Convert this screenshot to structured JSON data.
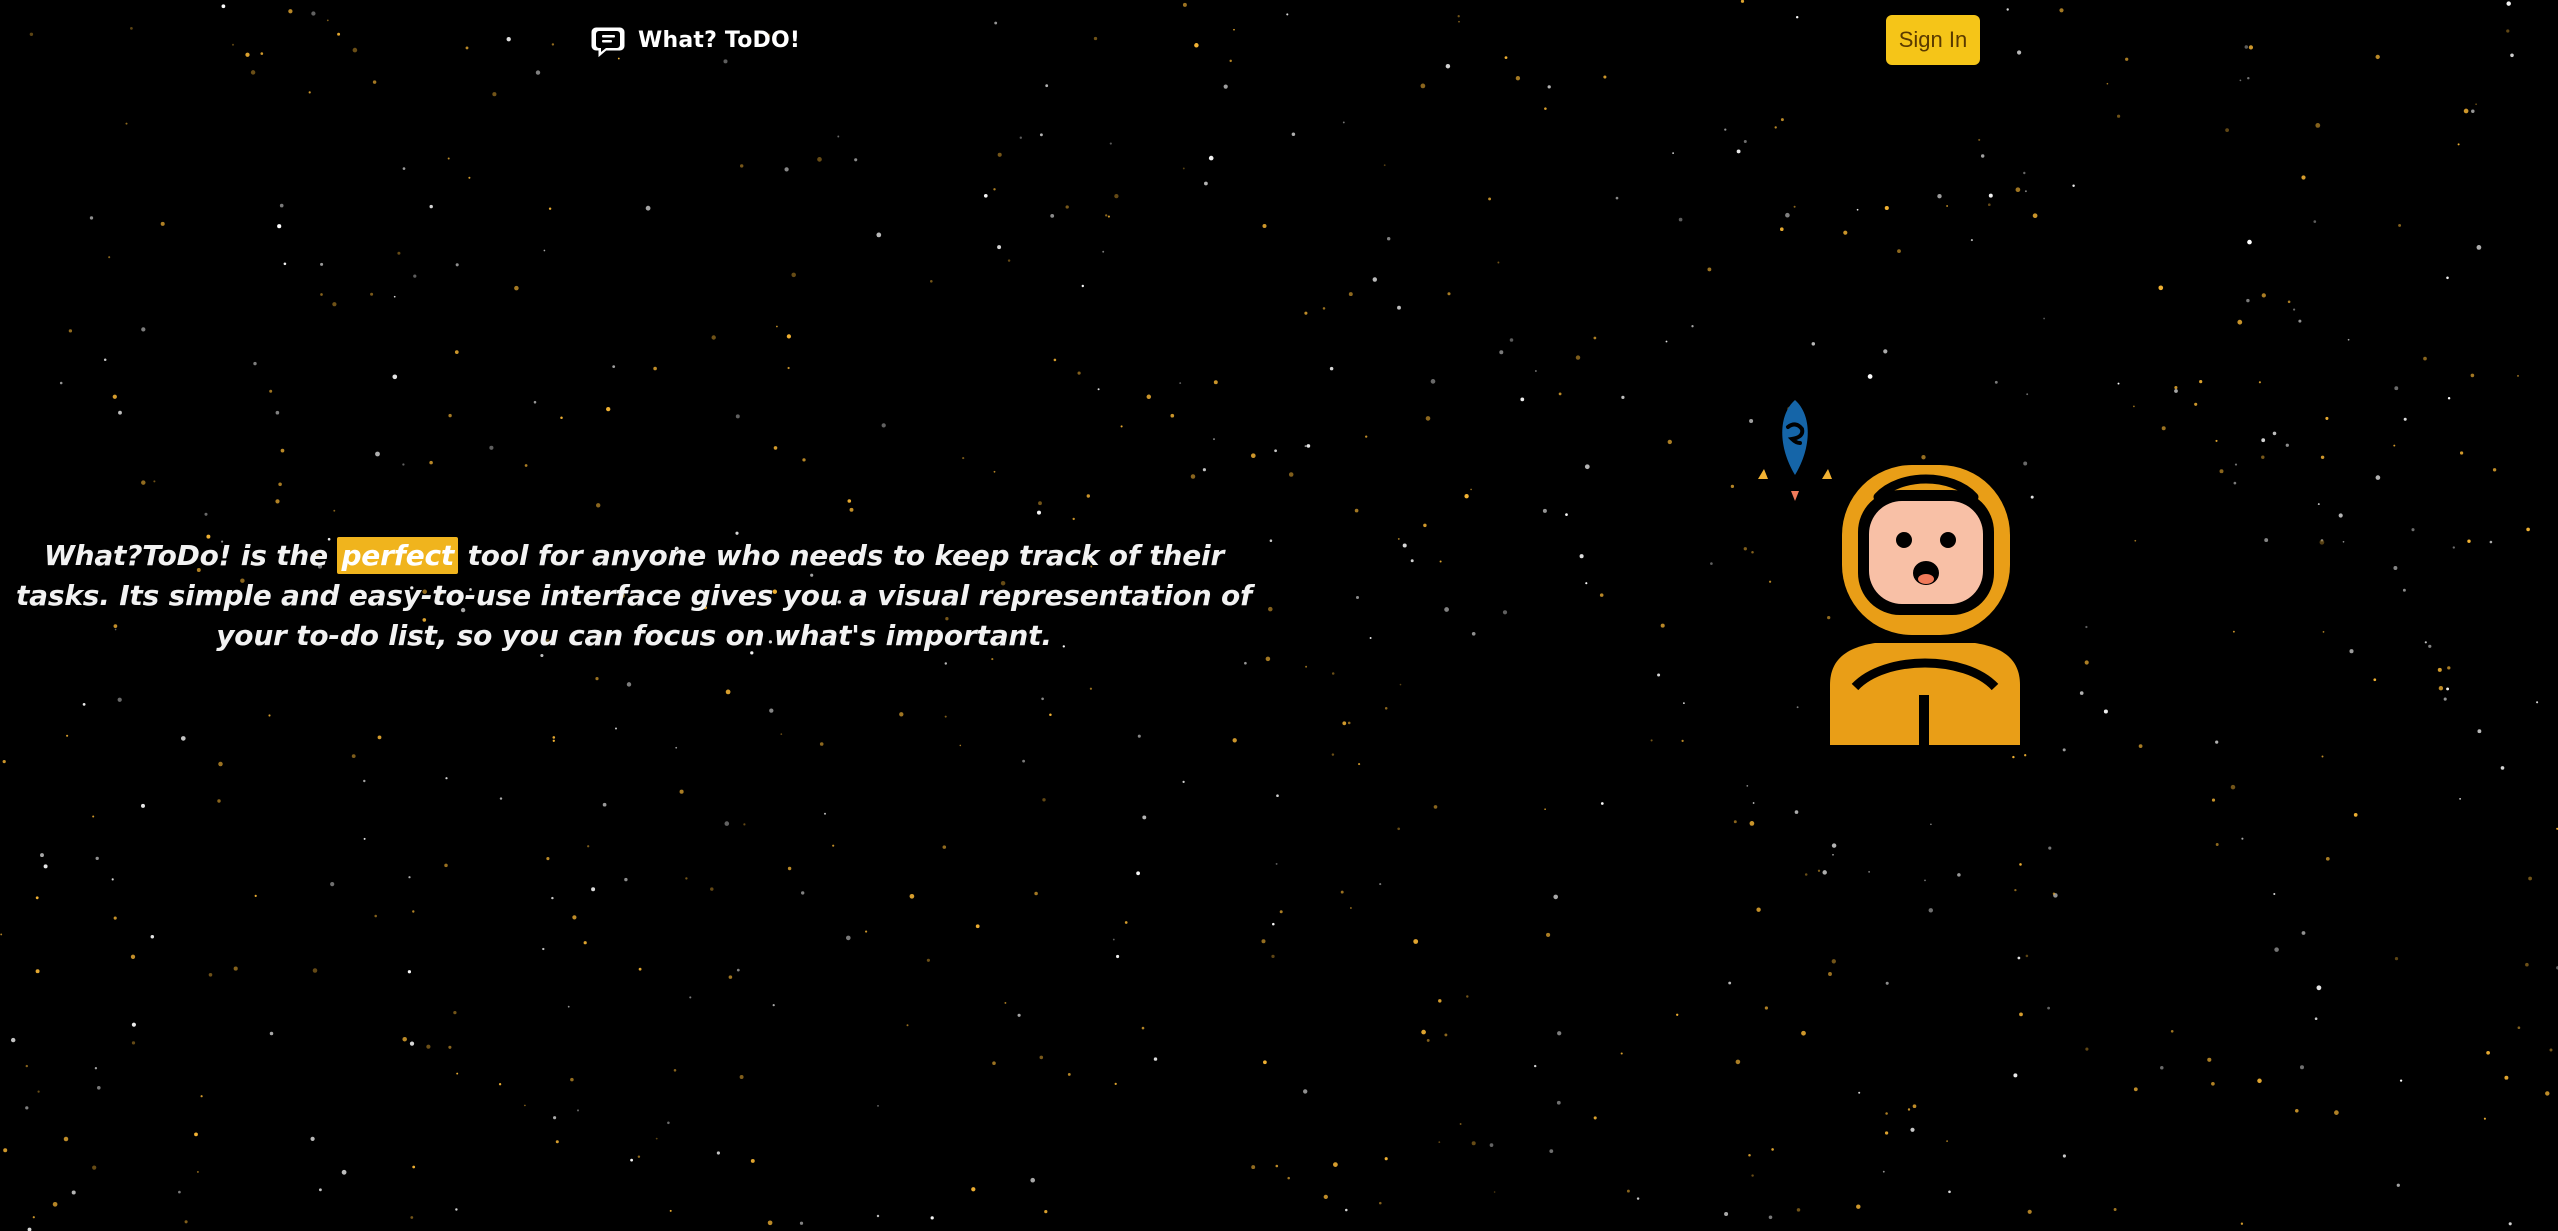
{
  "navbar": {
    "brand_name": "What? ToDO!",
    "signin_label": "Sign In"
  },
  "hero": {
    "text_before": "What?ToDo! is the ",
    "highlight": "perfect",
    "text_after": " tool for anyone who needs to keep track of their tasks. Its simple and easy-to-use interface gives you a visual representation of your to-do list, so you can focus on what's important."
  },
  "colors": {
    "background": "#000000",
    "accent": "#f5c518",
    "highlight": "#f0b41d",
    "astronaut_suit": "#e99e17",
    "astronaut_face": "#f8c0a6",
    "rocket_body": "#1565a8",
    "rocket_flame": "#f07a5a",
    "star_gold": "#f2b233",
    "star_white": "#ffffff"
  },
  "icons": {
    "logo": "speech-bubble-logo-icon",
    "illustration": "astronaut-with-rocket"
  }
}
